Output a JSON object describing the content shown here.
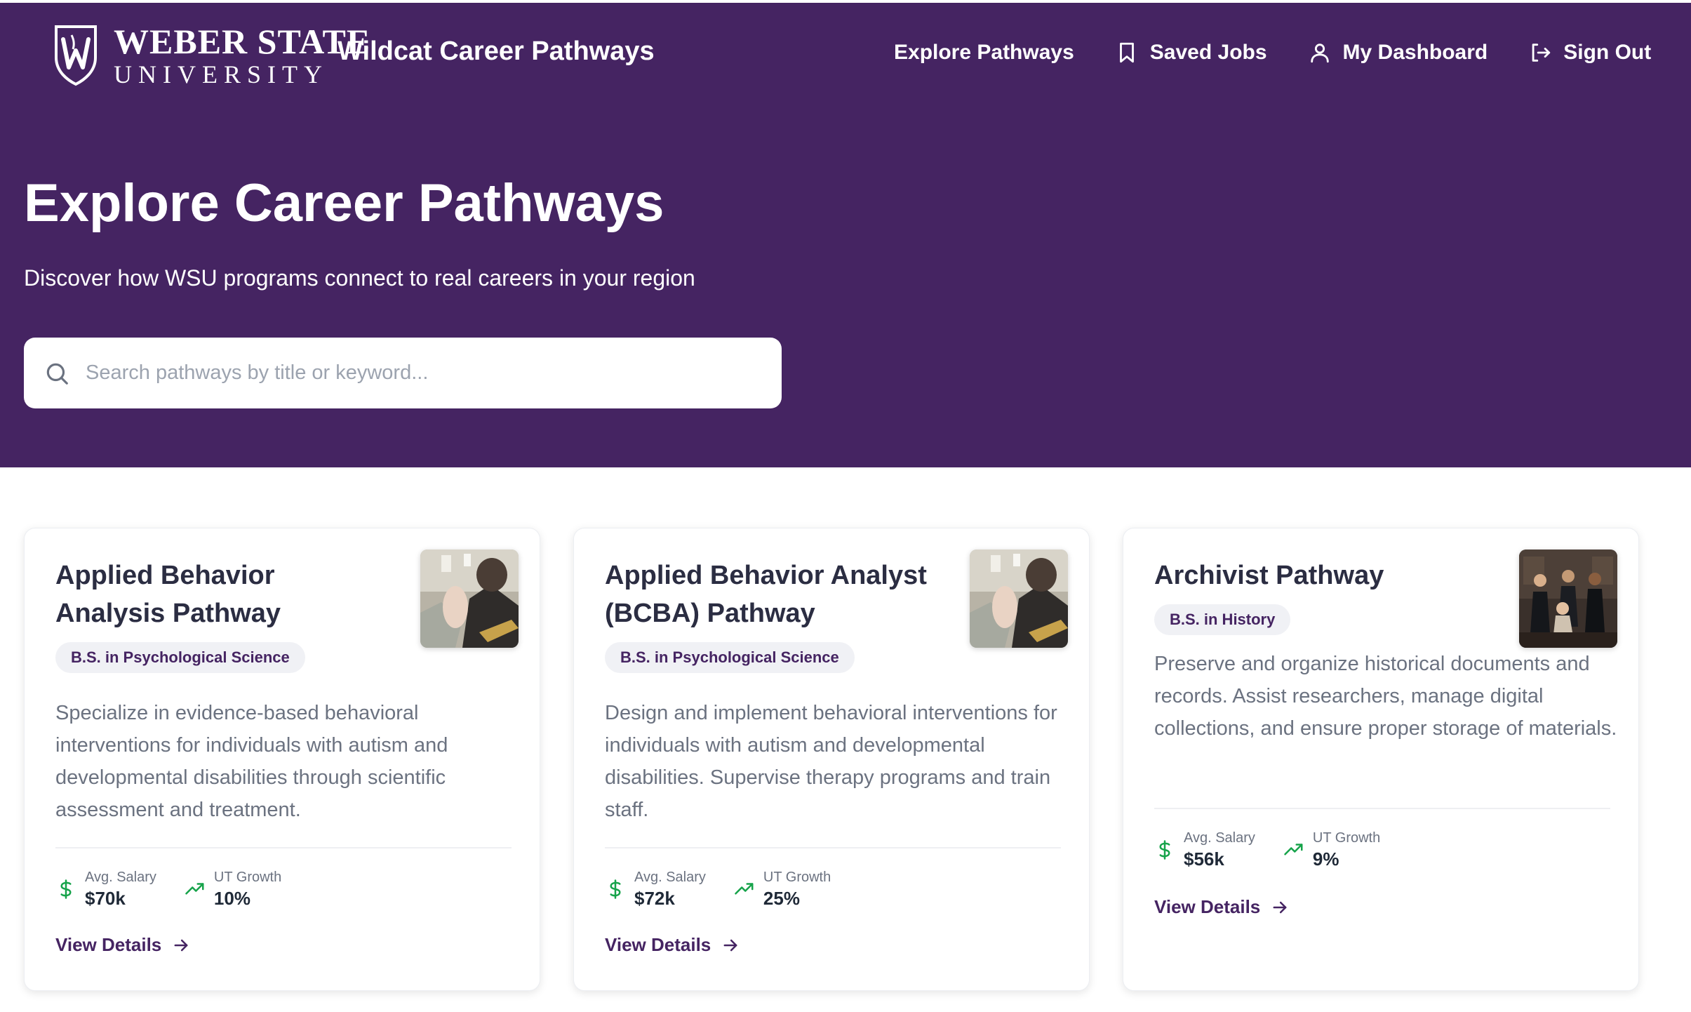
{
  "brand": {
    "university_line1": "WEBER STATE",
    "university_line2": "UNIVERSITY",
    "app_title": "Wildcat Career Pathways",
    "accent_color": "#452462"
  },
  "nav": {
    "items": [
      {
        "label": "Explore Pathways",
        "icon": null
      },
      {
        "label": "Saved Jobs",
        "icon": "bookmark-icon"
      },
      {
        "label": "My Dashboard",
        "icon": "user-icon"
      },
      {
        "label": "Sign Out",
        "icon": "sign-out-icon"
      }
    ]
  },
  "hero": {
    "title": "Explore Career Pathways",
    "subtitle": "Discover how WSU programs connect to real careers in your region"
  },
  "search": {
    "placeholder": "Search pathways by title or keyword...",
    "value": ""
  },
  "cards": [
    {
      "title": "Applied Behavior Analysis Pathway",
      "degree": "B.S. in Psychological Science",
      "description": "Specialize in evidence-based behavioral interventions for individuals with autism and developmental disabilities through scientific assessment and treatment.",
      "salary_label": "Avg. Salary",
      "salary_value": "$70k",
      "growth_label": "UT Growth",
      "growth_value": "10%",
      "link_label": "View Details",
      "image": "therapy-session-photo"
    },
    {
      "title": "Applied Behavior Analyst (BCBA) Pathway",
      "degree": "B.S. in Psychological Science",
      "description": "Design and implement behavioral interventions for individuals with autism and developmental disabilities. Supervise therapy programs and train staff.",
      "salary_label": "Avg. Salary",
      "salary_value": "$72k",
      "growth_label": "UT Growth",
      "growth_value": "25%",
      "link_label": "View Details",
      "image": "therapy-session-photo"
    },
    {
      "title": "Archivist Pathway",
      "degree": "B.S. in History",
      "description": "Preserve and organize historical documents and records. Assist researchers, manage digital collections, and ensure proper storage of materials.",
      "salary_label": "Avg. Salary",
      "salary_value": "$56k",
      "growth_label": "UT Growth",
      "growth_value": "9%",
      "link_label": "View Details",
      "image": "professionals-group-photo"
    }
  ]
}
